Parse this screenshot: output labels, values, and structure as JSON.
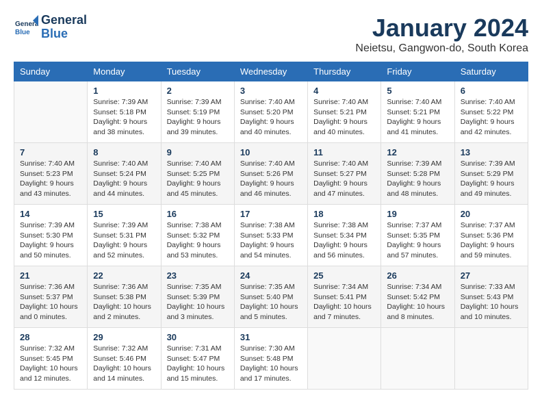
{
  "logo": {
    "line1": "General",
    "line2": "Blue"
  },
  "title": "January 2024",
  "location": "Neietsu, Gangwon-do, South Korea",
  "weekdays": [
    "Sunday",
    "Monday",
    "Tuesday",
    "Wednesday",
    "Thursday",
    "Friday",
    "Saturday"
  ],
  "weeks": [
    [
      {
        "day": "",
        "info": ""
      },
      {
        "day": "1",
        "info": "Sunrise: 7:39 AM\nSunset: 5:18 PM\nDaylight: 9 hours\nand 38 minutes."
      },
      {
        "day": "2",
        "info": "Sunrise: 7:39 AM\nSunset: 5:19 PM\nDaylight: 9 hours\nand 39 minutes."
      },
      {
        "day": "3",
        "info": "Sunrise: 7:40 AM\nSunset: 5:20 PM\nDaylight: 9 hours\nand 40 minutes."
      },
      {
        "day": "4",
        "info": "Sunrise: 7:40 AM\nSunset: 5:21 PM\nDaylight: 9 hours\nand 40 minutes."
      },
      {
        "day": "5",
        "info": "Sunrise: 7:40 AM\nSunset: 5:21 PM\nDaylight: 9 hours\nand 41 minutes."
      },
      {
        "day": "6",
        "info": "Sunrise: 7:40 AM\nSunset: 5:22 PM\nDaylight: 9 hours\nand 42 minutes."
      }
    ],
    [
      {
        "day": "7",
        "info": "Sunrise: 7:40 AM\nSunset: 5:23 PM\nDaylight: 9 hours\nand 43 minutes."
      },
      {
        "day": "8",
        "info": "Sunrise: 7:40 AM\nSunset: 5:24 PM\nDaylight: 9 hours\nand 44 minutes."
      },
      {
        "day": "9",
        "info": "Sunrise: 7:40 AM\nSunset: 5:25 PM\nDaylight: 9 hours\nand 45 minutes."
      },
      {
        "day": "10",
        "info": "Sunrise: 7:40 AM\nSunset: 5:26 PM\nDaylight: 9 hours\nand 46 minutes."
      },
      {
        "day": "11",
        "info": "Sunrise: 7:40 AM\nSunset: 5:27 PM\nDaylight: 9 hours\nand 47 minutes."
      },
      {
        "day": "12",
        "info": "Sunrise: 7:39 AM\nSunset: 5:28 PM\nDaylight: 9 hours\nand 48 minutes."
      },
      {
        "day": "13",
        "info": "Sunrise: 7:39 AM\nSunset: 5:29 PM\nDaylight: 9 hours\nand 49 minutes."
      }
    ],
    [
      {
        "day": "14",
        "info": "Sunrise: 7:39 AM\nSunset: 5:30 PM\nDaylight: 9 hours\nand 50 minutes."
      },
      {
        "day": "15",
        "info": "Sunrise: 7:39 AM\nSunset: 5:31 PM\nDaylight: 9 hours\nand 52 minutes."
      },
      {
        "day": "16",
        "info": "Sunrise: 7:38 AM\nSunset: 5:32 PM\nDaylight: 9 hours\nand 53 minutes."
      },
      {
        "day": "17",
        "info": "Sunrise: 7:38 AM\nSunset: 5:33 PM\nDaylight: 9 hours\nand 54 minutes."
      },
      {
        "day": "18",
        "info": "Sunrise: 7:38 AM\nSunset: 5:34 PM\nDaylight: 9 hours\nand 56 minutes."
      },
      {
        "day": "19",
        "info": "Sunrise: 7:37 AM\nSunset: 5:35 PM\nDaylight: 9 hours\nand 57 minutes."
      },
      {
        "day": "20",
        "info": "Sunrise: 7:37 AM\nSunset: 5:36 PM\nDaylight: 9 hours\nand 59 minutes."
      }
    ],
    [
      {
        "day": "21",
        "info": "Sunrise: 7:36 AM\nSunset: 5:37 PM\nDaylight: 10 hours\nand 0 minutes."
      },
      {
        "day": "22",
        "info": "Sunrise: 7:36 AM\nSunset: 5:38 PM\nDaylight: 10 hours\nand 2 minutes."
      },
      {
        "day": "23",
        "info": "Sunrise: 7:35 AM\nSunset: 5:39 PM\nDaylight: 10 hours\nand 3 minutes."
      },
      {
        "day": "24",
        "info": "Sunrise: 7:35 AM\nSunset: 5:40 PM\nDaylight: 10 hours\nand 5 minutes."
      },
      {
        "day": "25",
        "info": "Sunrise: 7:34 AM\nSunset: 5:41 PM\nDaylight: 10 hours\nand 7 minutes."
      },
      {
        "day": "26",
        "info": "Sunrise: 7:34 AM\nSunset: 5:42 PM\nDaylight: 10 hours\nand 8 minutes."
      },
      {
        "day": "27",
        "info": "Sunrise: 7:33 AM\nSunset: 5:43 PM\nDaylight: 10 hours\nand 10 minutes."
      }
    ],
    [
      {
        "day": "28",
        "info": "Sunrise: 7:32 AM\nSunset: 5:45 PM\nDaylight: 10 hours\nand 12 minutes."
      },
      {
        "day": "29",
        "info": "Sunrise: 7:32 AM\nSunset: 5:46 PM\nDaylight: 10 hours\nand 14 minutes."
      },
      {
        "day": "30",
        "info": "Sunrise: 7:31 AM\nSunset: 5:47 PM\nDaylight: 10 hours\nand 15 minutes."
      },
      {
        "day": "31",
        "info": "Sunrise: 7:30 AM\nSunset: 5:48 PM\nDaylight: 10 hours\nand 17 minutes."
      },
      {
        "day": "",
        "info": ""
      },
      {
        "day": "",
        "info": ""
      },
      {
        "day": "",
        "info": ""
      }
    ]
  ]
}
